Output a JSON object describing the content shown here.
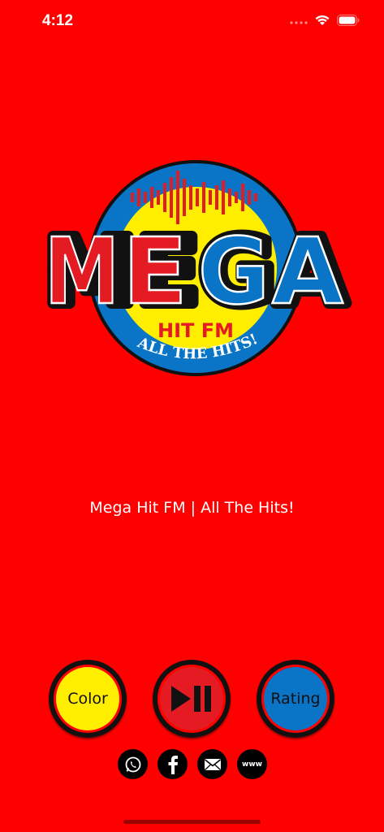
{
  "status_bar": {
    "time": "4:12"
  },
  "logo": {
    "wordmark": "MEGA",
    "sub_line": "HIT FM",
    "arc_text": "ALL THE HITS!"
  },
  "tagline": "Mega Hit FM | All The Hits!",
  "controls": {
    "color_label": "Color",
    "play_icon": "play-pause-icon",
    "rating_label": "Rating"
  },
  "social": [
    {
      "icon": "whatsapp-icon"
    },
    {
      "icon": "facebook-icon"
    },
    {
      "icon": "mail-icon"
    },
    {
      "icon": "website-icon",
      "label": "www"
    }
  ],
  "colors": {
    "background": "#FF0000",
    "yellow": "#FFEE00",
    "red": "#E51B24",
    "blue": "#0A74C6"
  }
}
